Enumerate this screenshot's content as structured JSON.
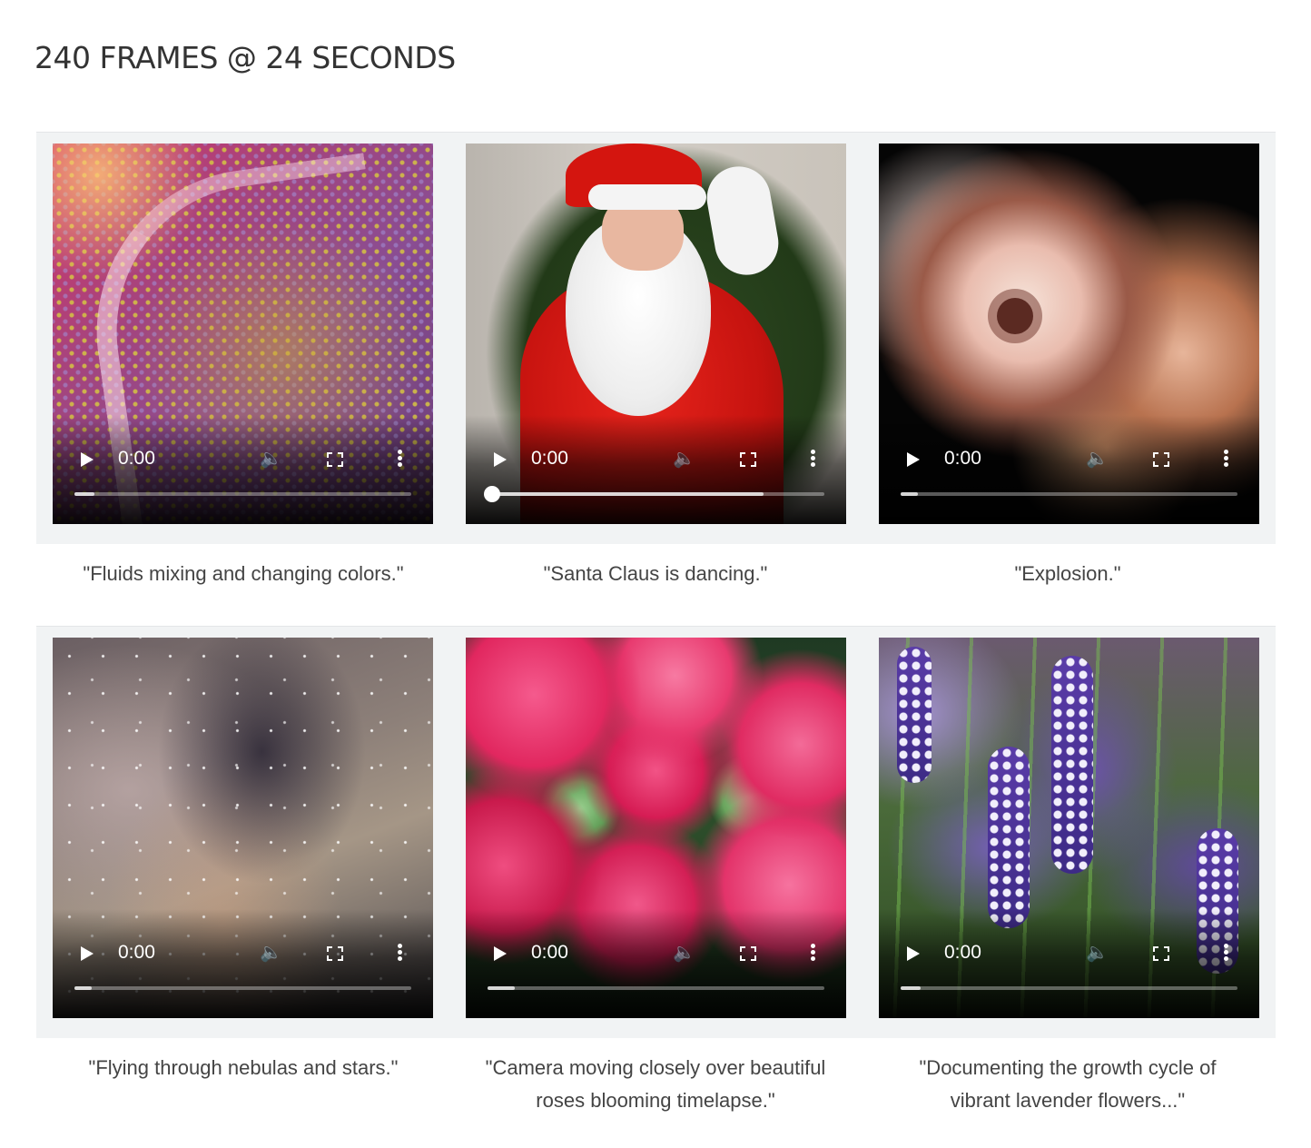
{
  "page": {
    "title": "240 FRAMES @ 24 SECONDS"
  },
  "videos": [
    {
      "caption": "\"Fluids mixing and changing colors.\"",
      "time": "0:00",
      "progress": 0.06
    },
    {
      "caption": "\"Santa Claus is dancing.\"",
      "time": "0:00",
      "progress": 0.82
    },
    {
      "caption": "\"Explosion.\"",
      "time": "0:00",
      "progress": 0.05
    },
    {
      "caption": "\"Flying through nebulas and stars.\"",
      "time": "0:00",
      "progress": 0.05
    },
    {
      "caption": "\"Camera moving closely over beautiful roses blooming timelapse.\"",
      "time": "0:00",
      "progress": 0.08
    },
    {
      "caption": "\"Documenting the growth cycle of vibrant lavender flowers...\"",
      "time": "0:00",
      "progress": 0.06
    }
  ],
  "icons": {
    "play": "play-icon",
    "volume": "volume-icon",
    "fullscreen": "fullscreen-icon",
    "more": "more-options-icon"
  },
  "colors": {
    "band": "#f1f3f4",
    "controls": "#ffffff",
    "caption_text": "#444444"
  }
}
